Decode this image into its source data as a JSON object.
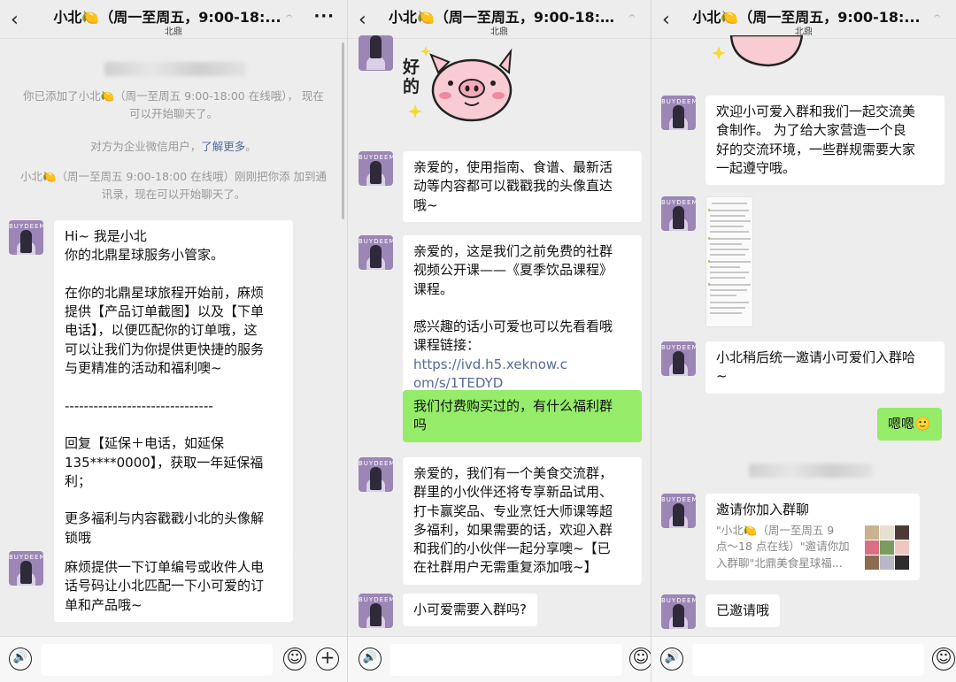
{
  "header": {
    "title": "小北🍋（周一至周五，9:00-18:...",
    "subtitle": "北鼎",
    "back_icon": "‹",
    "mute_icon": "𝄐",
    "more_label": "···"
  },
  "avatar_text": "BUYDEEM",
  "panel1": {
    "blurred_name": "",
    "sys1": "你已添加了小北🍋（周一至周五 9:00-18:00 在线哦），\n现在可以开始聊天了。",
    "sys2_text": "对方为企业微信用户，",
    "sys2_link": "了解更多",
    "sys2_end": "。",
    "sys3": "小北🍋（周一至周五 9:00-18:00 在线哦）刚刚把你添\n加到通讯录，现在可以开始聊天了。",
    "msg1": "Hi~ 我是小北\n你的北鼎星球服务小管家。\n\n在你的北鼎星球旅程开始前，麻烦\n提供【产品订单截图】以及【下单\n电话】，以便匹配你的订单哦，这\n可以让我们为你提供更快捷的服务\n与更精准的活动和福利噢~\n\n-------------------------------\n\n回复【延保＋电话，如延保\n135****0000】，获取一年延保福\n利；\n\n更多福利与内容戳戳小北的头像解\n锁哦",
    "msg2": "麻烦提供一下订单编号或收件人电\n话号码让小北匹配一下小可爱的订\n单和产品哦~"
  },
  "panel2": {
    "sticker_text": "好\n的",
    "msg1": "亲爱的，使用指南、食谱、最新活\n动等内容都可以戳戳我的头像直达\n哦~",
    "msg2_text": "亲爱的，这是我们之前免费的社群\n视频公开课——《夏季饮品课程》\n课程。\n\n感兴趣的话小可爱也可以先看看哦\n课程链接：",
    "msg2_link": "https://ivd.h5.xeknow.c\nom/s/1TEDYD",
    "msg3": "我们付费购买过的，有什么福利群\n吗",
    "msg4": "亲爱的，我们有一个美食交流群，\n群里的小伙伴还将专享新品试用、\n打卡赢奖品、专业烹饪大师课等超\n多福利，如果需要的话，欢迎入群\n和我们的小伙伴一起分享噢~【已\n在社群用户无需重复添加哦~】",
    "msg5": "小可爱需要入群吗?"
  },
  "panel3": {
    "msg1": "欢迎小可爱入群和我们一起交流美\n食制作。 为了给大家营造一个良\n好的交流环境，一些群规需要大家\n一起遵守哦。",
    "msg2": "小北稍后统一邀请小可爱们入群哈\n~",
    "msg3": "嗯嗯🙂",
    "card_title": "邀请你加入群聊",
    "card_desc": "\"小北🍋（周一至周五 9\n点～18 点在线）\"邀请你加\n入群聊\"北鼎美食星球福...",
    "msg4": "已邀请哦"
  },
  "colors": {
    "chat_bg": "#ededed",
    "bubble_white": "#ffffff",
    "bubble_green": "#95ec69",
    "link": "#576b95",
    "avatar": "#9b86b6"
  },
  "input_bar": {
    "voice_icon": "🔊",
    "emoji_icon": "☺",
    "plus_icon": "+"
  }
}
